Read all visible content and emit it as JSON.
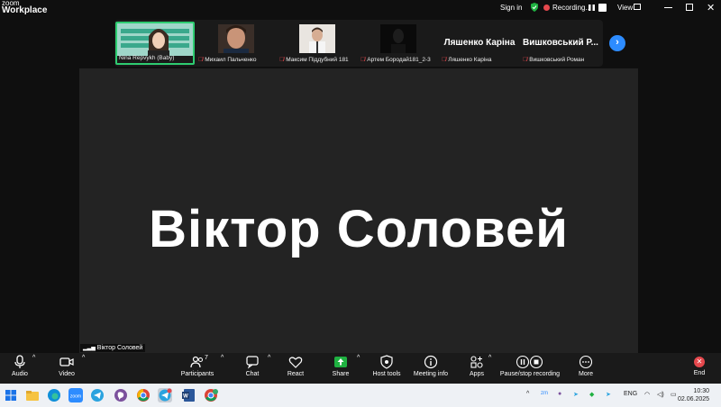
{
  "app": {
    "brand_line1": "zoom",
    "brand_line2": "Workplace"
  },
  "topbar": {
    "signin": "Sign in",
    "recording": "Recording...",
    "view": "View"
  },
  "thumbnails": [
    {
      "name": "Nina Repvykh (Baby)",
      "muted": false,
      "active": true
    },
    {
      "name": "Михаил Пальченко",
      "muted": true
    },
    {
      "name": "Максим Піддубний 181",
      "muted": true
    },
    {
      "name": "Артем Бородай181_2-3",
      "muted": true
    },
    {
      "name": "Ляшенко Каріна",
      "display_name": "Ляшенко Каріна",
      "muted": true
    },
    {
      "name": "Вишковський Роман",
      "display_name": "Вишковський Р...",
      "muted": true
    }
  ],
  "stage": {
    "speaker_name": "Віктор Соловей",
    "speaker_tag": "Віктор Соловей"
  },
  "toolbar": {
    "audio": "Audio",
    "video": "Video",
    "participants": "Participants",
    "participants_count": "7",
    "chat": "Chat",
    "react": "React",
    "share": "Share",
    "host_tools": "Host tools",
    "meeting_info": "Meeting info",
    "apps": "Apps",
    "pause_stop": "Pause/stop recording",
    "more": "More",
    "end": "End"
  },
  "taskbar": {
    "lang": "ENG",
    "time": "10:30",
    "date": "02.06.2025"
  },
  "colors": {
    "accent": "#2d8cff",
    "active_border": "#2ecc71",
    "record_red": "#e5484d",
    "share_green": "#1fb141"
  }
}
